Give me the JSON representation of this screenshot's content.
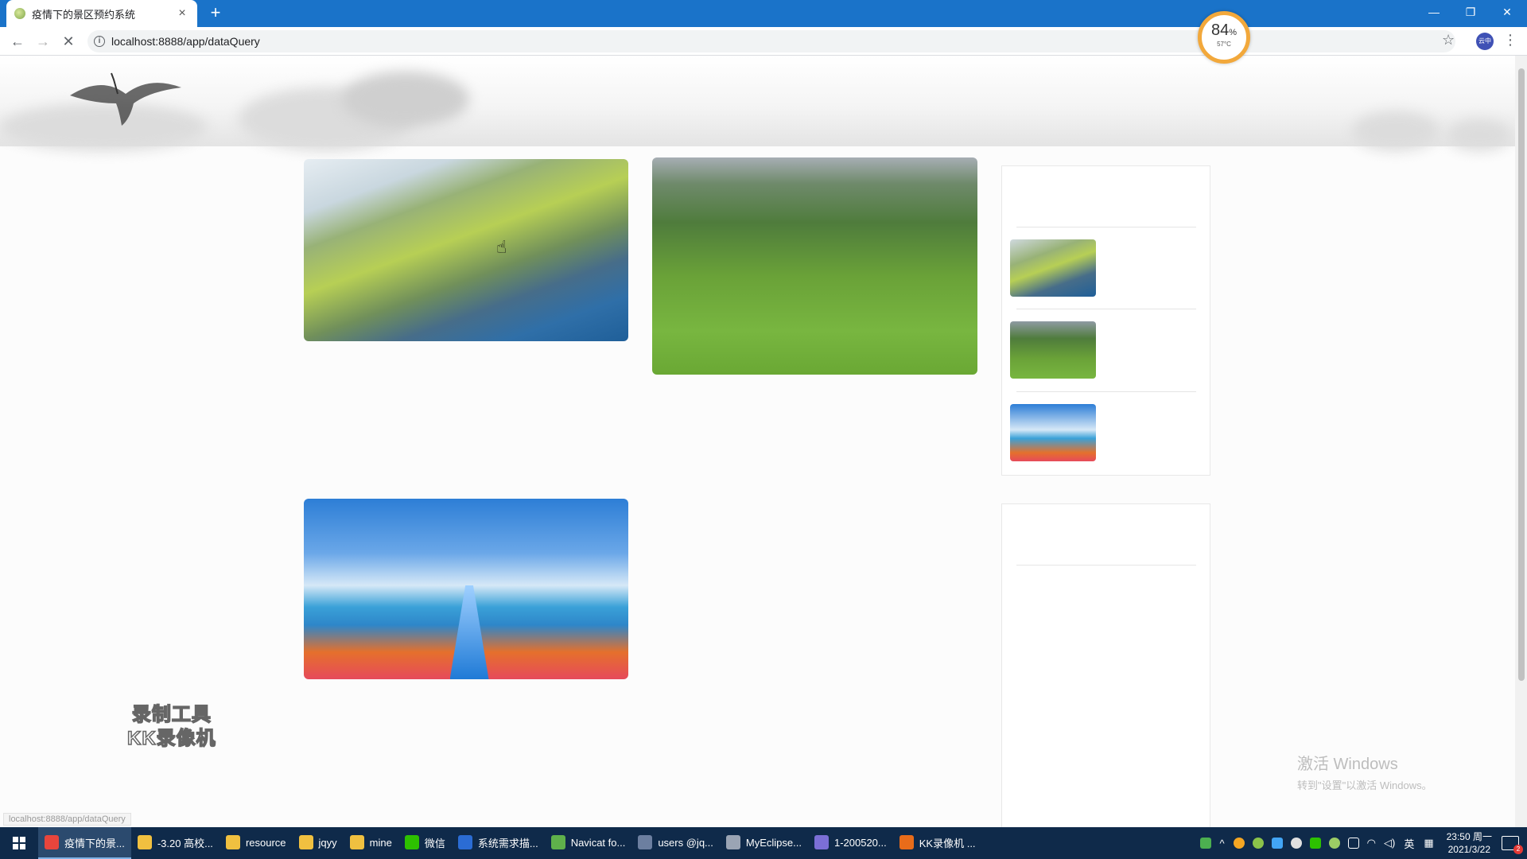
{
  "browser": {
    "tab_title": "疫情下的景区预约系统",
    "tab_close": "×",
    "new_tab": "+",
    "url": "localhost:8888/app/dataQuery",
    "status_url": "localhost:8888/app/dataQuery",
    "window_controls": [
      "—",
      "❐",
      "✕"
    ]
  },
  "gauge": {
    "value": "84",
    "unit": "%",
    "temperature": "57°C"
  },
  "page": {
    "attraction_images": [
      "park-aerial-photo",
      "meadow-photo",
      "water-slide-photo"
    ],
    "sidebar_thumbnails": [
      "park-aerial-thumb",
      "meadow-thumb",
      "water-slide-thumb"
    ]
  },
  "overlay": {
    "watermark_line1": "录制工具",
    "watermark_line2": "KK录像机",
    "activate_title": "激活 Windows",
    "activate_subtitle": "转到\"设置\"以激活 Windows。"
  },
  "taskbar": {
    "items": [
      {
        "label": "疫情下的景...",
        "icon": "chrome-icon",
        "color": "#e8453c",
        "active": true
      },
      {
        "label": "-3.20 高校...",
        "icon": "folder-icon",
        "color": "#f0c040",
        "active": false
      },
      {
        "label": "resource",
        "icon": "folder-icon",
        "color": "#f0c040",
        "active": false
      },
      {
        "label": "jqyy",
        "icon": "folder-icon",
        "color": "#f0c040",
        "active": false
      },
      {
        "label": "mine",
        "icon": "folder-icon",
        "color": "#f0c040",
        "active": false
      },
      {
        "label": "微信",
        "icon": "wechat-icon",
        "color": "#2dc100",
        "active": false
      },
      {
        "label": "系统需求描...",
        "icon": "word-icon",
        "color": "#2b6cd4",
        "active": false
      },
      {
        "label": "Navicat fo...",
        "icon": "navicat-icon",
        "color": "#5fb14b",
        "active": false
      },
      {
        "label": "users @jq...",
        "icon": "table-icon",
        "color": "#6c7fa0",
        "active": false
      },
      {
        "label": "MyEclipse...",
        "icon": "eclipse-icon",
        "color": "#9aa4b4",
        "active": false
      },
      {
        "label": "1-200520...",
        "icon": "app-icon",
        "color": "#7b6fd6",
        "active": false
      },
      {
        "label": "KK录像机 ...",
        "icon": "recorder-icon",
        "color": "#e86c1a",
        "active": false
      }
    ],
    "ime": "英",
    "time": "23:50 周一",
    "date": "2021/3/22",
    "notification_count": "2"
  }
}
